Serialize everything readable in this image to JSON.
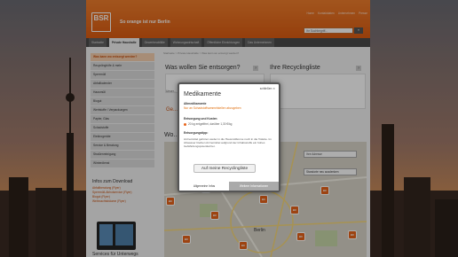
{
  "header": {
    "logo_text": "BSR",
    "slogan": "So orange ist nur Berlin",
    "top_links": [
      "Home",
      "Kontaktdaten",
      "Unternehmen",
      "Presse"
    ],
    "search_placeholder": "Ihr Suchbegriff...",
    "search_button": "»"
  },
  "nav": {
    "tabs": [
      "Startseite",
      "Private Haushalte",
      "Gewerbeabfälle",
      "Wohnungswirtschaft",
      "Öffentliche Einrichtungen",
      "Das Unternehmen"
    ],
    "active_index": 1
  },
  "breadcrumb": "Startseite > Private Haushalte > Was kann wo entsorgt werden?",
  "sidebar": {
    "items": [
      "Was kann wo entsorgt werden?",
      "Recyclinghöfe & mehr",
      "Sperrmüll",
      "Abfallkalender",
      "Hausmüll",
      "Biogut",
      "Wertstoffe / Verpackungen",
      "Papier, Glas",
      "Schadstoffe",
      "Elektrogeräte",
      "Service & Beratung",
      "Straßenreinigung",
      "Winterdienst"
    ]
  },
  "downloads": {
    "title": "Infos zum Download",
    "links": [
      "Abfallberatung (Flyer)",
      "Sperrmüll-Abholservice (Flyer)",
      "Biogut (Flyer)",
      "Weihnachtsbäume (Flyer)"
    ]
  },
  "services_title": "Services für Unterwegs",
  "main": {
    "question_title": "Was wollen Sie entsorgen?",
    "recycling_title": "Ihre Recyclingliste",
    "help_badge": "?",
    "small_label": "Unser...",
    "link_text": "Ge...",
    "map_title": "Wo..."
  },
  "map": {
    "city_label": "Berlin",
    "select_label": "Ihre Adresse",
    "button_label": "Standorte neu ausdenken",
    "marker_label": "BC"
  },
  "modal": {
    "close_label": "schließen",
    "title": "Medikamente",
    "subtitle": "Altmedikamente",
    "warning": "Nur an Schadstoffsammelstellen abzugeben",
    "cost_heading": "Entsorgung und Kosten",
    "cost_text": "20 kg entgeltfrei, darüber 1,30 €/kg",
    "tip_heading": "Entsorgungstipp:",
    "tip_text": "Arzneimittel gehören weder in die Hausmülltonne noch in die Toilette. Im Abwasser bleiben Arzneimittel aufgrund der Inhaltsstoffe ein hohes Gefährdungspotential bei.",
    "button_label": "Auf meine Recyclingliste",
    "tab_left": "Allgemeine Infos",
    "tab_right": "Weitere Informationen"
  }
}
